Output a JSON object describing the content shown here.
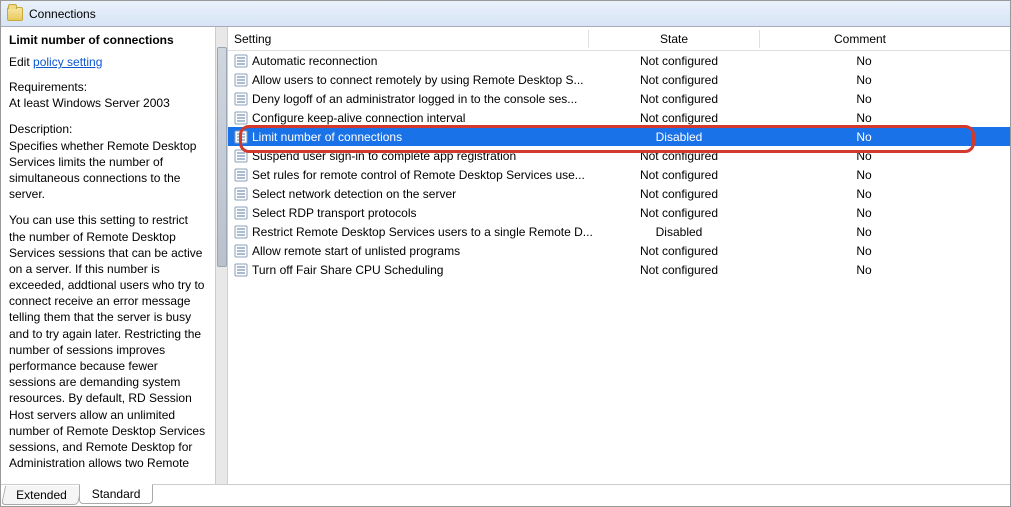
{
  "title": "Connections",
  "leftPane": {
    "heading": "Limit number of connections",
    "editPrefix": "Edit ",
    "editLink": "policy setting ",
    "requirementsLabel": "Requirements:",
    "requirementsValue": "At least Windows Server 2003",
    "descriptionLabel": "Description:",
    "descriptionText": "Specifies whether Remote Desktop Services limits the number of simultaneous connections to the server.",
    "descriptionPara2": "You can use this setting to restrict the number of Remote Desktop Services sessions that can be active on a server. If this number is exceeded, addtional users who try to connect receive an error message telling them that the server is busy and to try again later. Restricting the number of sessions improves performance because fewer sessions are demanding system resources. By default, RD Session Host servers allow an unlimited number of Remote Desktop Services sessions, and Remote Desktop for Administration allows two Remote"
  },
  "columns": {
    "setting": "Setting",
    "state": "State",
    "comment": "Comment"
  },
  "rows": [
    {
      "setting": "Automatic reconnection",
      "state": "Not configured",
      "comment": "No",
      "selected": false
    },
    {
      "setting": "Allow users to connect remotely by using Remote Desktop S...",
      "state": "Not configured",
      "comment": "No",
      "selected": false
    },
    {
      "setting": "Deny logoff of an administrator logged in to the console ses...",
      "state": "Not configured",
      "comment": "No",
      "selected": false
    },
    {
      "setting": "Configure keep-alive connection interval",
      "state": "Not configured",
      "comment": "No",
      "selected": false
    },
    {
      "setting": "Limit number of connections",
      "state": "Disabled",
      "comment": "No",
      "selected": true
    },
    {
      "setting": "Suspend user sign-in to complete app registration",
      "state": "Not configured",
      "comment": "No",
      "selected": false
    },
    {
      "setting": "Set rules for remote control of Remote Desktop Services use...",
      "state": "Not configured",
      "comment": "No",
      "selected": false
    },
    {
      "setting": "Select network detection on the server",
      "state": "Not configured",
      "comment": "No",
      "selected": false
    },
    {
      "setting": "Select RDP transport protocols",
      "state": "Not configured",
      "comment": "No",
      "selected": false
    },
    {
      "setting": "Restrict Remote Desktop Services users to a single Remote D...",
      "state": "Disabled",
      "comment": "No",
      "selected": false
    },
    {
      "setting": "Allow remote start of unlisted programs",
      "state": "Not configured",
      "comment": "No",
      "selected": false
    },
    {
      "setting": "Turn off Fair Share CPU Scheduling",
      "state": "Not configured",
      "comment": "No",
      "selected": false
    }
  ],
  "tabs": {
    "extended": "Extended",
    "standard": "Standard"
  }
}
